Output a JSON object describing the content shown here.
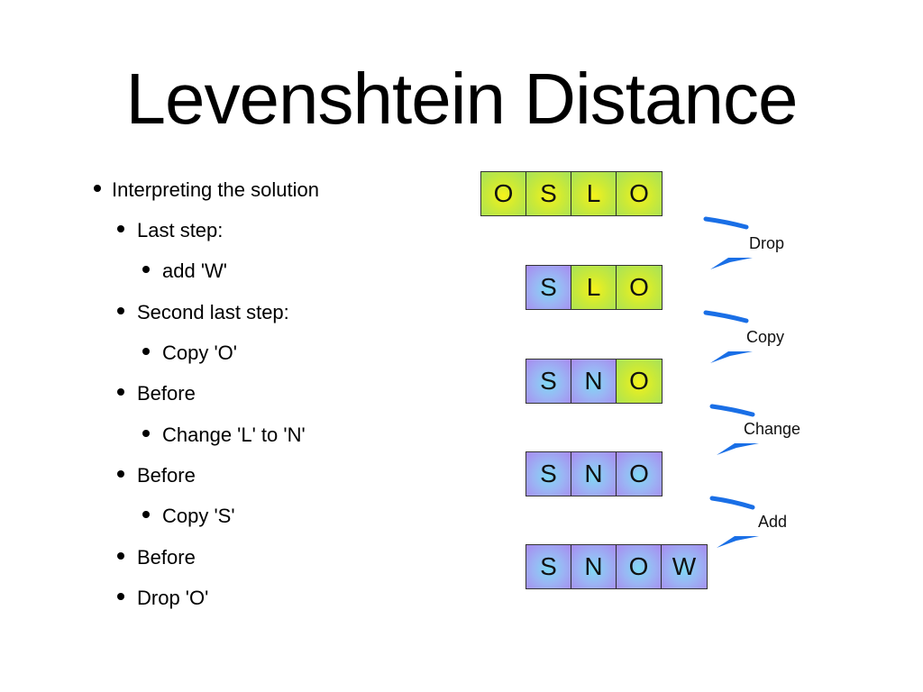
{
  "title": "Levenshtein Distance",
  "bullets": [
    {
      "level": 1,
      "text": "Interpreting the solution"
    },
    {
      "level": 2,
      "text": "Last step:"
    },
    {
      "level": 3,
      "text": "add 'W'"
    },
    {
      "level": 2,
      "text": "Second last step:"
    },
    {
      "level": 3,
      "text": "Copy 'O'"
    },
    {
      "level": 2,
      "text": "Before"
    },
    {
      "level": 3,
      "text": "Change 'L' to 'N'"
    },
    {
      "level": 2,
      "text": "Before"
    },
    {
      "level": 3,
      "text": "Copy 'S'"
    },
    {
      "level": 2,
      "text": "Before"
    },
    {
      "level": 2,
      "text": "Drop 'O'"
    }
  ],
  "diagram": {
    "words": [
      {
        "letters": [
          "O",
          "S",
          "L",
          "O"
        ],
        "colors": [
          "green",
          "green",
          "green",
          "green"
        ]
      },
      {
        "letters": [
          "S",
          "L",
          "O"
        ],
        "colors": [
          "blue",
          "green",
          "green"
        ]
      },
      {
        "letters": [
          "S",
          "N",
          "O"
        ],
        "colors": [
          "blue",
          "blue",
          "green"
        ]
      },
      {
        "letters": [
          "S",
          "N",
          "O"
        ],
        "colors": [
          "blue",
          "blue",
          "blue"
        ]
      },
      {
        "letters": [
          "S",
          "N",
          "O",
          "W"
        ],
        "colors": [
          "blue",
          "blue",
          "blue",
          "blue"
        ]
      }
    ],
    "operations": [
      "Drop",
      "Copy",
      "Change",
      "Add"
    ],
    "arrow_color": "#1a73e8"
  }
}
